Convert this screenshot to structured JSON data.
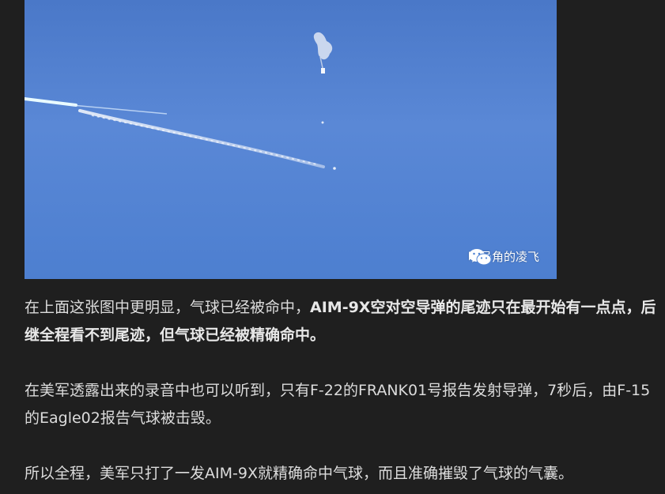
{
  "image": {
    "watermark_text": "吹号角的凌飞",
    "sky_color": "#5285d4",
    "trail_color": "#eaf4ff"
  },
  "article": {
    "p1_normal": "在上面这张图中更明显，气球已经被命中，",
    "p1_bold": "AIM-9X空对空导弹的尾迹只在最开始有一点点，后继全程看不到尾迹，但气球已经被精确命中。",
    "p2": "在美军透露出来的录音中也可以听到，只有F-22的FRANK01号报告发射导弹，7秒后，由F-15的Eagle02报告气球被击毁。",
    "p3": "所以全程，美军只打了一发AIM-9X就精确命中气球，而且准确摧毁了气球的气囊。"
  }
}
